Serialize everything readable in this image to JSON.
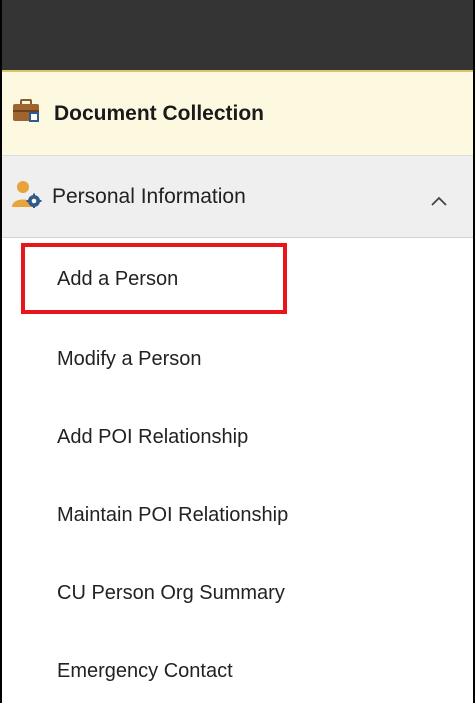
{
  "header": {
    "background": "#343434"
  },
  "document_collection": {
    "label": "Document Collection",
    "icon": "briefcase-icon"
  },
  "personal_information": {
    "label": "Personal Information",
    "icon": "person-gear-icon",
    "expanded": true
  },
  "menu": {
    "items": [
      {
        "label": "Add a Person",
        "highlighted": true
      },
      {
        "label": "Modify a Person"
      },
      {
        "label": "Add POI Relationship"
      },
      {
        "label": "Maintain POI Relationship"
      },
      {
        "label": "CU Person Org Summary"
      },
      {
        "label": "Emergency Contact"
      }
    ]
  },
  "colors": {
    "highlight": "#e8161b",
    "doc_collection_bg": "#fdf9e1",
    "section_bg": "#efefef",
    "icon_orange": "#e8a33b",
    "icon_blue": "#2f5b8c"
  }
}
